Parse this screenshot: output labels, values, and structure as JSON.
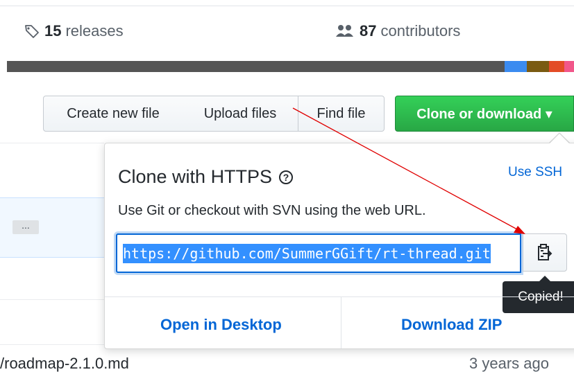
{
  "stats": {
    "releases_count": "15",
    "releases_label": "releases",
    "contributors_count": "87",
    "contributors_label": "contributors"
  },
  "toolbar": {
    "create_new_file": "Create new file",
    "upload_files": "Upload files",
    "find_file": "Find file",
    "clone_or_download": "Clone or download ▾"
  },
  "file_list": {
    "ellipsis": "...",
    "bottom_file_name": "/roadmap-2.1.0.md",
    "bottom_file_time": "3 years ago"
  },
  "clone_panel": {
    "title": "Clone with HTTPS",
    "help_symbol": "?",
    "use_ssh": "Use SSH",
    "description": "Use Git or checkout with SVN using the web URL.",
    "url_value": "https://github.com/SummerGGift/rt-thread.git",
    "copy_tooltip": "Copied!",
    "open_in_desktop": "Open in Desktop",
    "download_zip": "Download ZIP"
  },
  "colors": {
    "accent_blue": "#0366d6",
    "green_button": "#28a745",
    "selection": "#3390ff",
    "annotation_red": "#e00000"
  }
}
